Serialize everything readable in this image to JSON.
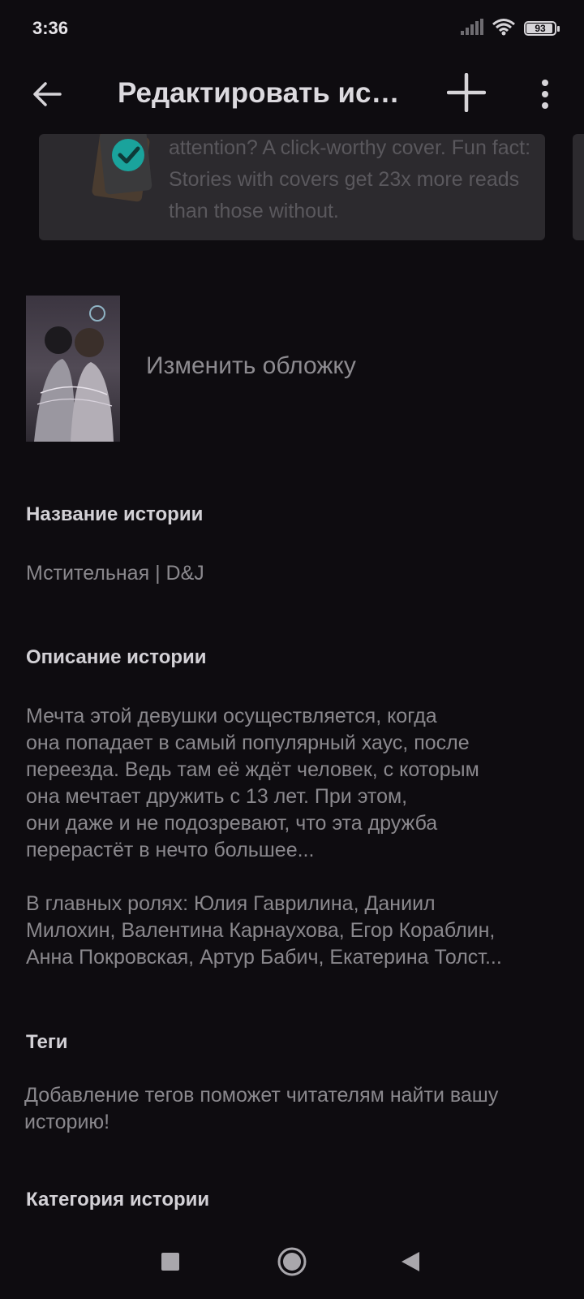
{
  "status_bar": {
    "time": "3:36",
    "battery": "93",
    "battery_level": 0.93
  },
  "toolbar": {
    "title": "Редактировать историю"
  },
  "promo": {
    "text": "attention? A click-worthy cover. Fun fact: Stories with covers get 23x more reads than those without."
  },
  "cover": {
    "change_label": "Изменить обложку"
  },
  "story_title": {
    "label": "Название истории",
    "value": "Мстительная | D&J"
  },
  "story_description": {
    "label": "Описание истории",
    "value": "Мечта этой девушки осуществляется, когда\nона попадает в самый популярный хаус, после\nпереезда. Ведь там её ждёт человек, с которым\nона мечтает дружить с 13 лет. При этом,\nони даже и не подозревают, что эта дружба\nперерастёт в нечто большее...\n\nВ главных ролях: Юлия Гаврилина, Даниил\nМилохин, Валентина Карнаухова, Егор Кораблин,\nАнна Покровская, Артур Бабич, Екатерина Толст..."
  },
  "tags": {
    "label": "Теги",
    "placeholder": "Добавление тегов поможет читателям найти вашу историю!"
  },
  "category": {
    "label": "Категория истории"
  },
  "icons": {
    "back": "arrow-back-icon",
    "add": "plus-icon",
    "more": "more-vert-icon",
    "wifi": "wifi-icon",
    "signal": "signal-icon",
    "battery": "battery-icon",
    "promo": "cover-check-icon",
    "nav_recents": "recents-square-icon",
    "nav_home": "home-circle-icon",
    "nav_back": "back-triangle-icon"
  },
  "colors": {
    "background": "#0e0c10",
    "card": "#2c2a2e",
    "accent_teal": "#1aa39c"
  }
}
